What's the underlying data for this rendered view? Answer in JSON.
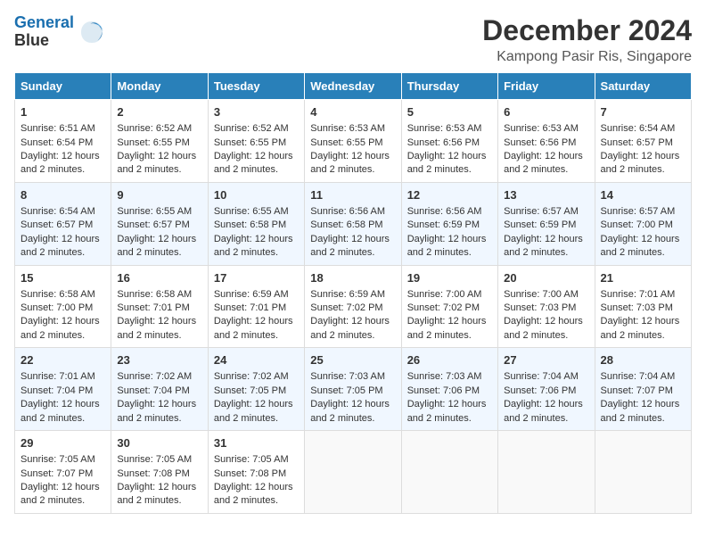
{
  "logo": {
    "line1": "General",
    "line2": "Blue"
  },
  "title": "December 2024",
  "subtitle": "Kampong Pasir Ris, Singapore",
  "days_header": [
    "Sunday",
    "Monday",
    "Tuesday",
    "Wednesday",
    "Thursday",
    "Friday",
    "Saturday"
  ],
  "weeks": [
    [
      {
        "day": "1",
        "sunrise": "6:51 AM",
        "sunset": "6:54 PM",
        "daylight": "12 hours and 2 minutes."
      },
      {
        "day": "2",
        "sunrise": "6:52 AM",
        "sunset": "6:55 PM",
        "daylight": "12 hours and 2 minutes."
      },
      {
        "day": "3",
        "sunrise": "6:52 AM",
        "sunset": "6:55 PM",
        "daylight": "12 hours and 2 minutes."
      },
      {
        "day": "4",
        "sunrise": "6:53 AM",
        "sunset": "6:55 PM",
        "daylight": "12 hours and 2 minutes."
      },
      {
        "day": "5",
        "sunrise": "6:53 AM",
        "sunset": "6:56 PM",
        "daylight": "12 hours and 2 minutes."
      },
      {
        "day": "6",
        "sunrise": "6:53 AM",
        "sunset": "6:56 PM",
        "daylight": "12 hours and 2 minutes."
      },
      {
        "day": "7",
        "sunrise": "6:54 AM",
        "sunset": "6:57 PM",
        "daylight": "12 hours and 2 minutes."
      }
    ],
    [
      {
        "day": "8",
        "sunrise": "6:54 AM",
        "sunset": "6:57 PM",
        "daylight": "12 hours and 2 minutes."
      },
      {
        "day": "9",
        "sunrise": "6:55 AM",
        "sunset": "6:57 PM",
        "daylight": "12 hours and 2 minutes."
      },
      {
        "day": "10",
        "sunrise": "6:55 AM",
        "sunset": "6:58 PM",
        "daylight": "12 hours and 2 minutes."
      },
      {
        "day": "11",
        "sunrise": "6:56 AM",
        "sunset": "6:58 PM",
        "daylight": "12 hours and 2 minutes."
      },
      {
        "day": "12",
        "sunrise": "6:56 AM",
        "sunset": "6:59 PM",
        "daylight": "12 hours and 2 minutes."
      },
      {
        "day": "13",
        "sunrise": "6:57 AM",
        "sunset": "6:59 PM",
        "daylight": "12 hours and 2 minutes."
      },
      {
        "day": "14",
        "sunrise": "6:57 AM",
        "sunset": "7:00 PM",
        "daylight": "12 hours and 2 minutes."
      }
    ],
    [
      {
        "day": "15",
        "sunrise": "6:58 AM",
        "sunset": "7:00 PM",
        "daylight": "12 hours and 2 minutes."
      },
      {
        "day": "16",
        "sunrise": "6:58 AM",
        "sunset": "7:01 PM",
        "daylight": "12 hours and 2 minutes."
      },
      {
        "day": "17",
        "sunrise": "6:59 AM",
        "sunset": "7:01 PM",
        "daylight": "12 hours and 2 minutes."
      },
      {
        "day": "18",
        "sunrise": "6:59 AM",
        "sunset": "7:02 PM",
        "daylight": "12 hours and 2 minutes."
      },
      {
        "day": "19",
        "sunrise": "7:00 AM",
        "sunset": "7:02 PM",
        "daylight": "12 hours and 2 minutes."
      },
      {
        "day": "20",
        "sunrise": "7:00 AM",
        "sunset": "7:03 PM",
        "daylight": "12 hours and 2 minutes."
      },
      {
        "day": "21",
        "sunrise": "7:01 AM",
        "sunset": "7:03 PM",
        "daylight": "12 hours and 2 minutes."
      }
    ],
    [
      {
        "day": "22",
        "sunrise": "7:01 AM",
        "sunset": "7:04 PM",
        "daylight": "12 hours and 2 minutes."
      },
      {
        "day": "23",
        "sunrise": "7:02 AM",
        "sunset": "7:04 PM",
        "daylight": "12 hours and 2 minutes."
      },
      {
        "day": "24",
        "sunrise": "7:02 AM",
        "sunset": "7:05 PM",
        "daylight": "12 hours and 2 minutes."
      },
      {
        "day": "25",
        "sunrise": "7:03 AM",
        "sunset": "7:05 PM",
        "daylight": "12 hours and 2 minutes."
      },
      {
        "day": "26",
        "sunrise": "7:03 AM",
        "sunset": "7:06 PM",
        "daylight": "12 hours and 2 minutes."
      },
      {
        "day": "27",
        "sunrise": "7:04 AM",
        "sunset": "7:06 PM",
        "daylight": "12 hours and 2 minutes."
      },
      {
        "day": "28",
        "sunrise": "7:04 AM",
        "sunset": "7:07 PM",
        "daylight": "12 hours and 2 minutes."
      }
    ],
    [
      {
        "day": "29",
        "sunrise": "7:05 AM",
        "sunset": "7:07 PM",
        "daylight": "12 hours and 2 minutes."
      },
      {
        "day": "30",
        "sunrise": "7:05 AM",
        "sunset": "7:08 PM",
        "daylight": "12 hours and 2 minutes."
      },
      {
        "day": "31",
        "sunrise": "7:05 AM",
        "sunset": "7:08 PM",
        "daylight": "12 hours and 2 minutes."
      },
      null,
      null,
      null,
      null
    ]
  ]
}
